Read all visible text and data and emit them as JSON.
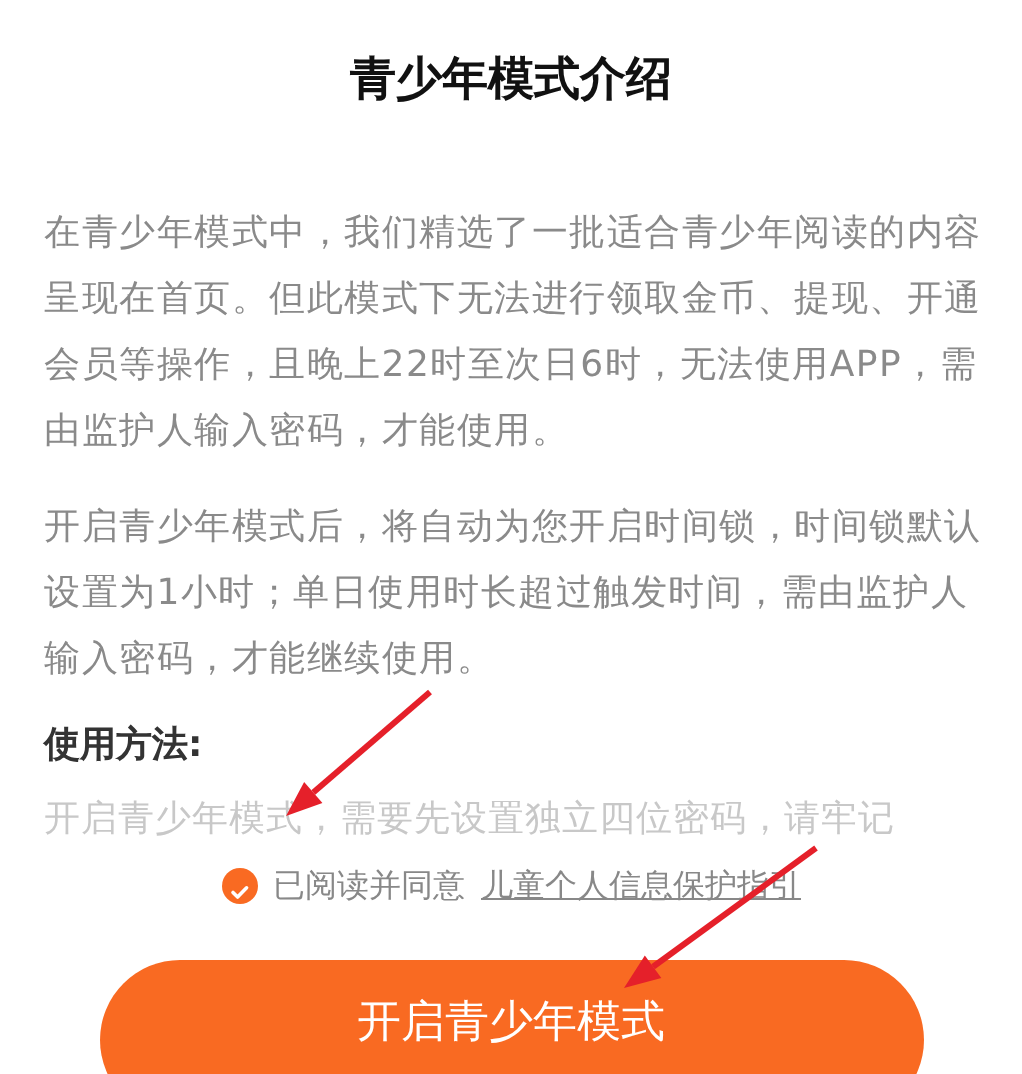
{
  "title": "青少年模式介绍",
  "paragraphs": [
    "在青少年模式中，我们精选了一批适合青少年阅读的内容呈现在首页。但此模式下无法进行领取金币、提现、开通会员等操作，且晚上22时至次日6时，无法使用APP，需由监护人输入密码，才能使用。",
    "开启青少年模式后，将自动为您开启时间锁，时间锁默认设置为1小时；单日使用时长超过触发时间，需由监护人输入密码，才能继续使用。"
  ],
  "usage": {
    "heading": "使用方法:",
    "text": "开启青少年模式，需要先设置独立四位密码，请牢记"
  },
  "agreement": {
    "checked": true,
    "text": "已阅读并同意",
    "link": "儿童个人信息保护指引"
  },
  "button": "开启青少年模式"
}
